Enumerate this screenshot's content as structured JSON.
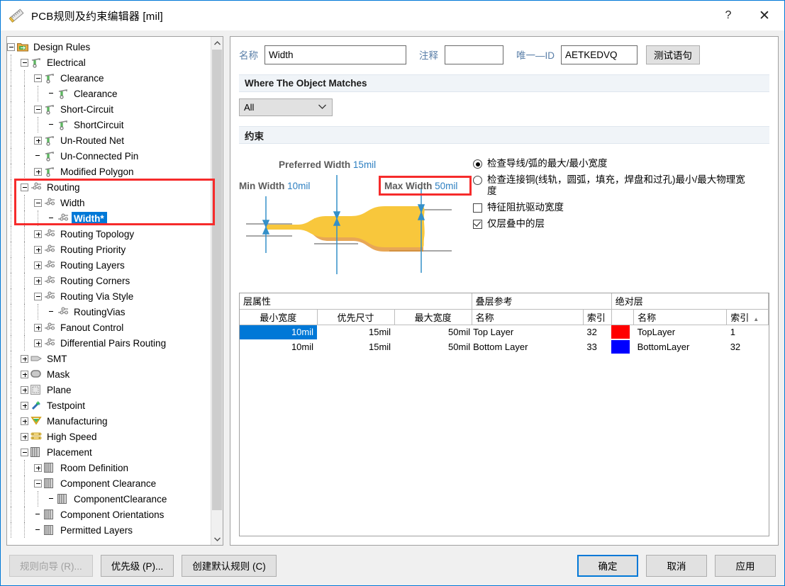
{
  "window": {
    "title": "PCB规则及约束编辑器 [mil]",
    "icon": "ruler-pencil-icon",
    "help_label": "?",
    "close_label": "✕",
    "accent": "#0078d7"
  },
  "tree": {
    "items": [
      {
        "label": "Design Rules",
        "indent": 0,
        "expander": "minus",
        "icon": "folder-icon",
        "selected": false
      },
      {
        "label": "Electrical",
        "indent": 1,
        "expander": "minus",
        "icon": "electrical-icon",
        "selected": false
      },
      {
        "label": "Clearance",
        "indent": 2,
        "expander": "minus",
        "icon": "electrical-icon",
        "selected": false
      },
      {
        "label": "Clearance",
        "indent": 3,
        "expander": "none",
        "icon": "electrical-icon",
        "selected": false
      },
      {
        "label": "Short-Circuit",
        "indent": 2,
        "expander": "minus",
        "icon": "electrical-icon",
        "selected": false
      },
      {
        "label": "ShortCircuit",
        "indent": 3,
        "expander": "none",
        "icon": "electrical-icon",
        "selected": false
      },
      {
        "label": "Un-Routed Net",
        "indent": 2,
        "expander": "plus",
        "icon": "electrical-icon",
        "selected": false
      },
      {
        "label": "Un-Connected Pin",
        "indent": 2,
        "expander": "none",
        "icon": "electrical-icon",
        "selected": false
      },
      {
        "label": "Modified Polygon",
        "indent": 2,
        "expander": "plus",
        "icon": "electrical-icon",
        "selected": false
      },
      {
        "label": "Routing",
        "indent": 1,
        "expander": "minus",
        "icon": "routing-icon",
        "selected": false
      },
      {
        "label": "Width",
        "indent": 2,
        "expander": "minus",
        "icon": "routing-icon",
        "selected": false
      },
      {
        "label": "Width*",
        "indent": 3,
        "expander": "none",
        "icon": "routing-icon",
        "selected": true
      },
      {
        "label": "Routing Topology",
        "indent": 2,
        "expander": "plus",
        "icon": "routing-icon",
        "selected": false
      },
      {
        "label": "Routing Priority",
        "indent": 2,
        "expander": "plus",
        "icon": "routing-icon",
        "selected": false
      },
      {
        "label": "Routing Layers",
        "indent": 2,
        "expander": "plus",
        "icon": "routing-icon",
        "selected": false
      },
      {
        "label": "Routing Corners",
        "indent": 2,
        "expander": "plus",
        "icon": "routing-icon",
        "selected": false
      },
      {
        "label": "Routing Via Style",
        "indent": 2,
        "expander": "minus",
        "icon": "routing-icon",
        "selected": false
      },
      {
        "label": "RoutingVias",
        "indent": 3,
        "expander": "none",
        "icon": "routing-icon",
        "selected": false
      },
      {
        "label": "Fanout Control",
        "indent": 2,
        "expander": "plus",
        "icon": "routing-icon",
        "selected": false
      },
      {
        "label": "Differential Pairs Routing",
        "indent": 2,
        "expander": "plus",
        "icon": "routing-icon",
        "selected": false
      },
      {
        "label": "SMT",
        "indent": 1,
        "expander": "plus",
        "icon": "smt-icon",
        "selected": false
      },
      {
        "label": "Mask",
        "indent": 1,
        "expander": "plus",
        "icon": "mask-icon",
        "selected": false
      },
      {
        "label": "Plane",
        "indent": 1,
        "expander": "plus",
        "icon": "plane-icon",
        "selected": false
      },
      {
        "label": "Testpoint",
        "indent": 1,
        "expander": "plus",
        "icon": "testpoint-icon",
        "selected": false
      },
      {
        "label": "Manufacturing",
        "indent": 1,
        "expander": "plus",
        "icon": "manufacturing-icon",
        "selected": false
      },
      {
        "label": "High Speed",
        "indent": 1,
        "expander": "plus",
        "icon": "high-speed-icon",
        "selected": false
      },
      {
        "label": "Placement",
        "indent": 1,
        "expander": "minus",
        "icon": "chip-icon",
        "selected": false
      },
      {
        "label": "Room Definition",
        "indent": 2,
        "expander": "plus",
        "icon": "chip-icon",
        "selected": false
      },
      {
        "label": "Component Clearance",
        "indent": 2,
        "expander": "minus",
        "icon": "chip-icon",
        "selected": false
      },
      {
        "label": "ComponentClearance",
        "indent": 3,
        "expander": "none",
        "icon": "chip-icon",
        "selected": false
      },
      {
        "label": "Component Orientations",
        "indent": 2,
        "expander": "none",
        "icon": "chip-icon",
        "selected": false
      },
      {
        "label": "Permitted Layers",
        "indent": 2,
        "expander": "none",
        "icon": "chip-icon",
        "selected": false
      }
    ],
    "scroll_up_icon": "chevron-up-icon",
    "scroll_down_icon": "chevron-down-icon",
    "highlight_box_color": "#f62b2b"
  },
  "form": {
    "name_label": "名称",
    "name_value": "Width",
    "comment_label": "注释",
    "comment_value": "",
    "unique_id_label": "唯一—ID",
    "unique_id_value": "AETKEDVQ",
    "test_query_button": "测试语句"
  },
  "where_section": {
    "title": "Where The Object Matches",
    "scope_value": "All",
    "chevron": "chevron-down-icon"
  },
  "constraint_section": {
    "title": "约束",
    "diagram": {
      "min_width_label": "Min Width",
      "min_width_value": "10mil",
      "preferred_width_label": "Preferred Width",
      "preferred_width_value": "15mil",
      "max_width_label": "Max Width",
      "max_width_value": "50mil",
      "trace_color": "#f8c73c",
      "arrow_color": "#3490c9"
    },
    "options": [
      {
        "type": "radio",
        "checked": true,
        "label": "检查导线/弧的最大/最小宽度"
      },
      {
        "type": "radio",
        "checked": false,
        "label": "检查连接铜(线轨，圆弧，填充，焊盘和过孔)最小/最大物理宽度"
      },
      {
        "type": "checkbox",
        "checked": false,
        "label": "特征阻抗驱动宽度"
      },
      {
        "type": "checkbox",
        "checked": true,
        "label": "仅层叠中的层"
      }
    ]
  },
  "table": {
    "group_headers": [
      {
        "label": "层属性",
        "span": 3
      },
      {
        "label": "叠层参考",
        "span": 2
      },
      {
        "label": "绝对层",
        "span": 3
      }
    ],
    "columns": [
      "最小宽度",
      "优先尺寸",
      "最大宽度",
      "名称",
      "索引",
      "",
      "名称",
      "索引"
    ],
    "sort_indicator": "▲",
    "rows": [
      {
        "min_width": "10mil",
        "preferred": "15mil",
        "max_width": "50mil",
        "stack_name": "Top Layer",
        "stack_index": "32",
        "layer_color": "#FF0000",
        "abs_name": "TopLayer",
        "abs_index": "1",
        "selected": true
      },
      {
        "min_width": "10mil",
        "preferred": "15mil",
        "max_width": "50mil",
        "stack_name": "Bottom Layer",
        "stack_index": "33",
        "layer_color": "#0000FF",
        "abs_name": "BottomLayer",
        "abs_index": "32",
        "selected": false
      }
    ]
  },
  "footer": {
    "rule_wizard": "规则向导 (R)...",
    "priority": "优先级 (P)...",
    "create_default": "创建默认规则 (C)",
    "ok": "确定",
    "cancel": "取消",
    "apply": "应用"
  }
}
